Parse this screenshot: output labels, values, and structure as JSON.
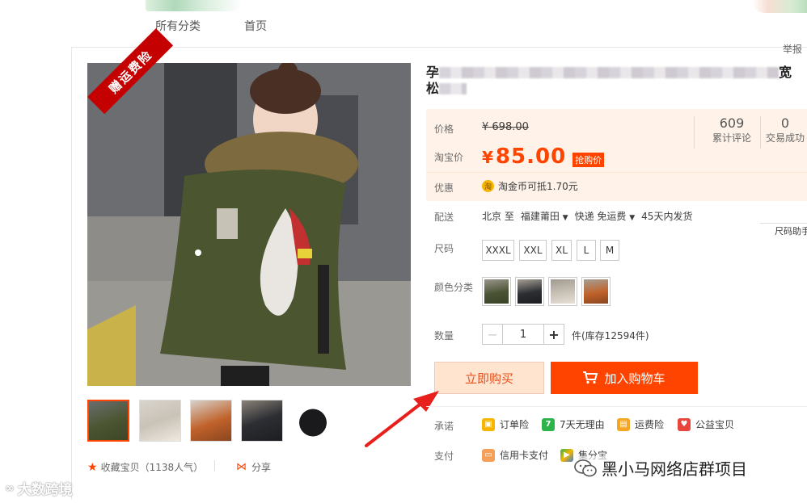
{
  "nav": {
    "all_categories": "所有分类",
    "home": "首页",
    "report": "举报"
  },
  "gallery": {
    "ribbon": "赠运费险",
    "thumbs": [
      "thumb-1",
      "thumb-2",
      "thumb-3",
      "thumb-4",
      "thumb-5"
    ],
    "favorite": "收藏宝贝（1138人气）",
    "share": "分享"
  },
  "product": {
    "title_start": "孕",
    "title_end": "宽",
    "title_line2_start": "松",
    "price_label": "价格",
    "original_price": "¥ 698.00",
    "taobao_price_label": "淘宝价",
    "currency": "¥",
    "current_price": "85.00",
    "promo_tag": "抢购价",
    "reviews_count": "609",
    "reviews_label": "累计评论",
    "sold_count": "0",
    "sold_label": "交易成功",
    "discount_label": "优惠",
    "coin_glyph": "淘",
    "discount_text": "淘金币可抵",
    "discount_amount": "1.70元",
    "shipping_label": "配送",
    "ship_from": "北京 至",
    "ship_to": "福建莆田",
    "express": "快递 免运费",
    "ship_time": "45天内发货",
    "size_helper": "尺码助手",
    "size_label": "尺码",
    "sizes": [
      "XXXL",
      "XXL",
      "XL",
      "L",
      "M"
    ],
    "color_label": "颜色分类",
    "colors": [
      "#4a5434",
      "#2c2e33",
      "#c9c2b7",
      "#c0622a"
    ],
    "quantity_label": "数量",
    "quantity": "1",
    "stock_text": "件(库存12594件)",
    "buy_now": "立即购买",
    "add_to_cart": "加入购物车",
    "promise_label": "承诺",
    "promises": [
      "订单险",
      "7天无理由",
      "运费险",
      "公益宝贝"
    ],
    "pay_label": "支付",
    "pay_methods": [
      "信用卡支付",
      "集分宝"
    ]
  },
  "watermarks": {
    "left": "大数跨境",
    "right": "黑小马网络店群项目"
  },
  "colors": {
    "accent": "#ff4400",
    "price_bg": "#fff2e8"
  }
}
